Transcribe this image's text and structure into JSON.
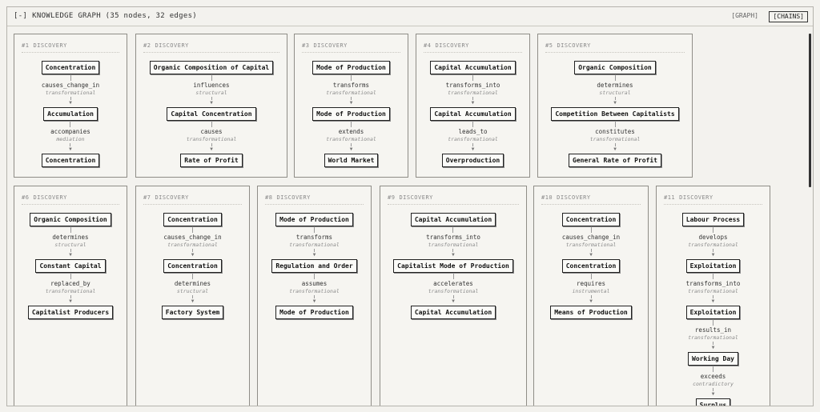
{
  "header": {
    "toggle": "[-]",
    "title": "KNOWLEDGE GRAPH (35 nodes, 32 edges)",
    "graph_btn": "[GRAPH]",
    "chains_btn": "[CHAINS]"
  },
  "cards": [
    {
      "num": "#1",
      "tag": "DISCOVERY",
      "nodes": [
        "Concentration",
        "Accumulation",
        "Concentration"
      ],
      "edges": [
        {
          "rel": "causes_change_in",
          "type": "transformational"
        },
        {
          "rel": "accompanies",
          "type": "mediation"
        }
      ]
    },
    {
      "num": "#2",
      "tag": "DISCOVERY",
      "nodes": [
        "Organic Composition of Capital",
        "Capital Concentration",
        "Rate of Profit"
      ],
      "edges": [
        {
          "rel": "influences",
          "type": "structural"
        },
        {
          "rel": "causes",
          "type": "transformational"
        }
      ]
    },
    {
      "num": "#3",
      "tag": "DISCOVERY",
      "nodes": [
        "Mode of Production",
        "Mode of Production",
        "World Market"
      ],
      "edges": [
        {
          "rel": "transforms",
          "type": "transformational"
        },
        {
          "rel": "extends",
          "type": "transformational"
        }
      ]
    },
    {
      "num": "#4",
      "tag": "DISCOVERY",
      "nodes": [
        "Capital Accumulation",
        "Capital Accumulation",
        "Overproduction"
      ],
      "edges": [
        {
          "rel": "transforms_into",
          "type": "transformational"
        },
        {
          "rel": "leads_to",
          "type": "transformational"
        }
      ]
    },
    {
      "num": "#5",
      "tag": "DISCOVERY",
      "nodes": [
        "Organic Composition",
        "Competition Between Capitalists",
        "General Rate of Profit"
      ],
      "edges": [
        {
          "rel": "determines",
          "type": "structural"
        },
        {
          "rel": "constitutes",
          "type": "transformational"
        }
      ]
    },
    {
      "num": "#6",
      "tag": "DISCOVERY",
      "nodes": [
        "Organic Composition",
        "Constant Capital",
        "Capitalist Producers"
      ],
      "edges": [
        {
          "rel": "determines",
          "type": "structural"
        },
        {
          "rel": "replaced_by",
          "type": "transformational"
        }
      ]
    },
    {
      "num": "#7",
      "tag": "DISCOVERY",
      "nodes": [
        "Concentration",
        "Concentration",
        "Factory System"
      ],
      "edges": [
        {
          "rel": "causes_change_in",
          "type": "transformational"
        },
        {
          "rel": "determines",
          "type": "structural"
        }
      ]
    },
    {
      "num": "#8",
      "tag": "DISCOVERY",
      "nodes": [
        "Mode of Production",
        "Regulation and Order",
        "Mode of Production"
      ],
      "edges": [
        {
          "rel": "transforms",
          "type": "transformational"
        },
        {
          "rel": "assumes",
          "type": "transformational"
        }
      ]
    },
    {
      "num": "#9",
      "tag": "DISCOVERY",
      "nodes": [
        "Capital Accumulation",
        "Capitalist Mode of Production",
        "Capital Accumulation"
      ],
      "edges": [
        {
          "rel": "transforms_into",
          "type": "transformational"
        },
        {
          "rel": "accelerates",
          "type": "transformational"
        }
      ]
    },
    {
      "num": "#10",
      "tag": "DISCOVERY",
      "nodes": [
        "Concentration",
        "Concentration",
        "Means of Production"
      ],
      "edges": [
        {
          "rel": "causes_change_in",
          "type": "transformational"
        },
        {
          "rel": "requires",
          "type": "instrumental"
        }
      ]
    },
    {
      "num": "#11",
      "tag": "DISCOVERY",
      "nodes": [
        "Labour Process",
        "Exploitation",
        "Exploitation",
        "Working Day",
        "Surplus"
      ],
      "edges": [
        {
          "rel": "develops",
          "type": "transformational"
        },
        {
          "rel": "transforms_into",
          "type": "transformational"
        },
        {
          "rel": "results_in",
          "type": "transformational"
        },
        {
          "rel": "exceeds",
          "type": "contradictory"
        }
      ]
    }
  ]
}
